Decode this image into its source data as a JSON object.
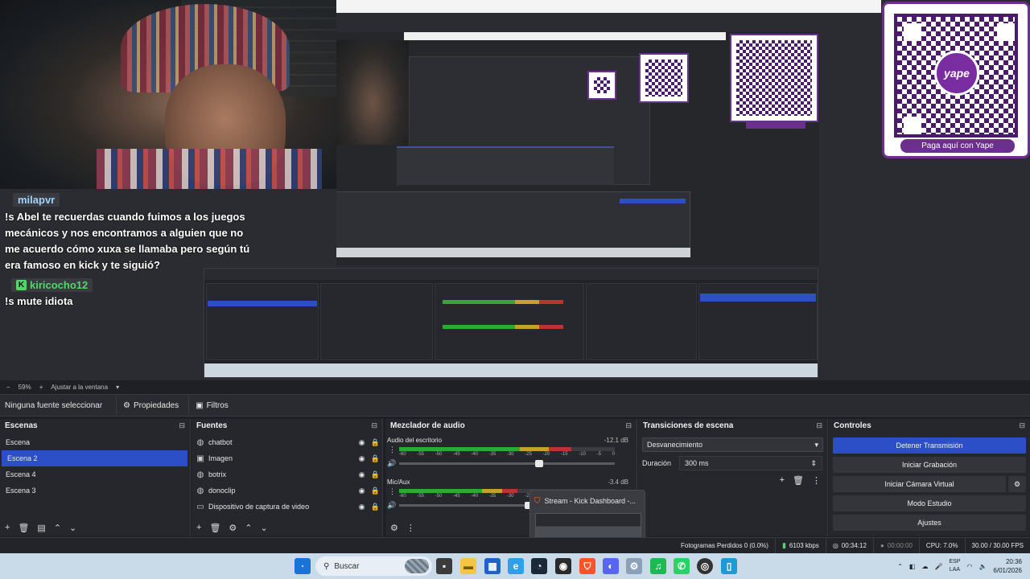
{
  "chat": {
    "messages": [
      {
        "user": "milapvr",
        "text": "!s Abel te recuerdas cuando fuimos a los juegos mecánicos y nos encontramos a alguien que no me acuerdo cómo xuxa se llamaba pero según tú era famoso en kick y te siguió?"
      },
      {
        "user": "kiricocho12",
        "text": "!s mute idiota"
      }
    ]
  },
  "yape": {
    "badge": "yape",
    "pay_label": "Paga aquí con Yape"
  },
  "obs_bar": {
    "zoom": "59%",
    "fit": "Ajustar a la ventana"
  },
  "source_bar": {
    "none_selected": "Ninguna fuente seleccionar",
    "properties": "Propiedades",
    "filters": "Filtros"
  },
  "scenes": {
    "title": "Escenas",
    "items": [
      "Escena",
      "Escena 2",
      "Escena 4",
      "Escena 3"
    ],
    "selected_index": 1
  },
  "sources": {
    "title": "Fuentes",
    "items": [
      {
        "label": "chatbot",
        "icon": "globe-icon"
      },
      {
        "label": "Imagen",
        "icon": "image-icon"
      },
      {
        "label": "botrix",
        "icon": "globe-icon"
      },
      {
        "label": "donoclip",
        "icon": "globe-icon"
      },
      {
        "label": "Dispositivo de captura de video",
        "icon": "camera-icon"
      }
    ]
  },
  "mixer": {
    "title": "Mezclador de audio",
    "channels": [
      {
        "name": "Audio del escritorio",
        "db": "-12.1 dB",
        "level": 0.8,
        "volume": 0.65
      },
      {
        "name": "Mic/Aux",
        "db": "-3.4 dB",
        "level": 0.55,
        "volume": 0.6
      }
    ],
    "scale": [
      "-60",
      "-55",
      "-50",
      "-45",
      "-40",
      "-35",
      "-30",
      "-25",
      "-20",
      "-15",
      "-10",
      "-5",
      "0"
    ]
  },
  "transitions": {
    "title": "Transiciones de escena",
    "selected": "Desvanecimiento",
    "duration_label": "Duración",
    "duration_value": "300 ms"
  },
  "controls": {
    "title": "Controles",
    "buttons": [
      "Detener Transmisión",
      "Iniciar Grabación",
      "Iniciar Cámara Virtual",
      "Modo Estudio",
      "Ajustes"
    ]
  },
  "popup": {
    "title": "Stream - Kick Dashboard -..."
  },
  "status": {
    "frames_dropped": "Fotogramas Perdidos 0 (0.0%)",
    "bitrate": "6103 kbps",
    "stream_time": "00:34:12",
    "rec_time": "00:00:00",
    "cpu": "CPU: 7.0%",
    "fps": "30.00 / 30.00 FPS"
  },
  "taskbar": {
    "search_placeholder": "Buscar",
    "lang_top": "ESP",
    "lang_bottom": "LAA",
    "time": "20:36",
    "date": "6/01/2026"
  },
  "colors": {
    "accent": "#2c4fc7",
    "yape": "#6b2f8c",
    "meter_green": "#2fa83a"
  }
}
